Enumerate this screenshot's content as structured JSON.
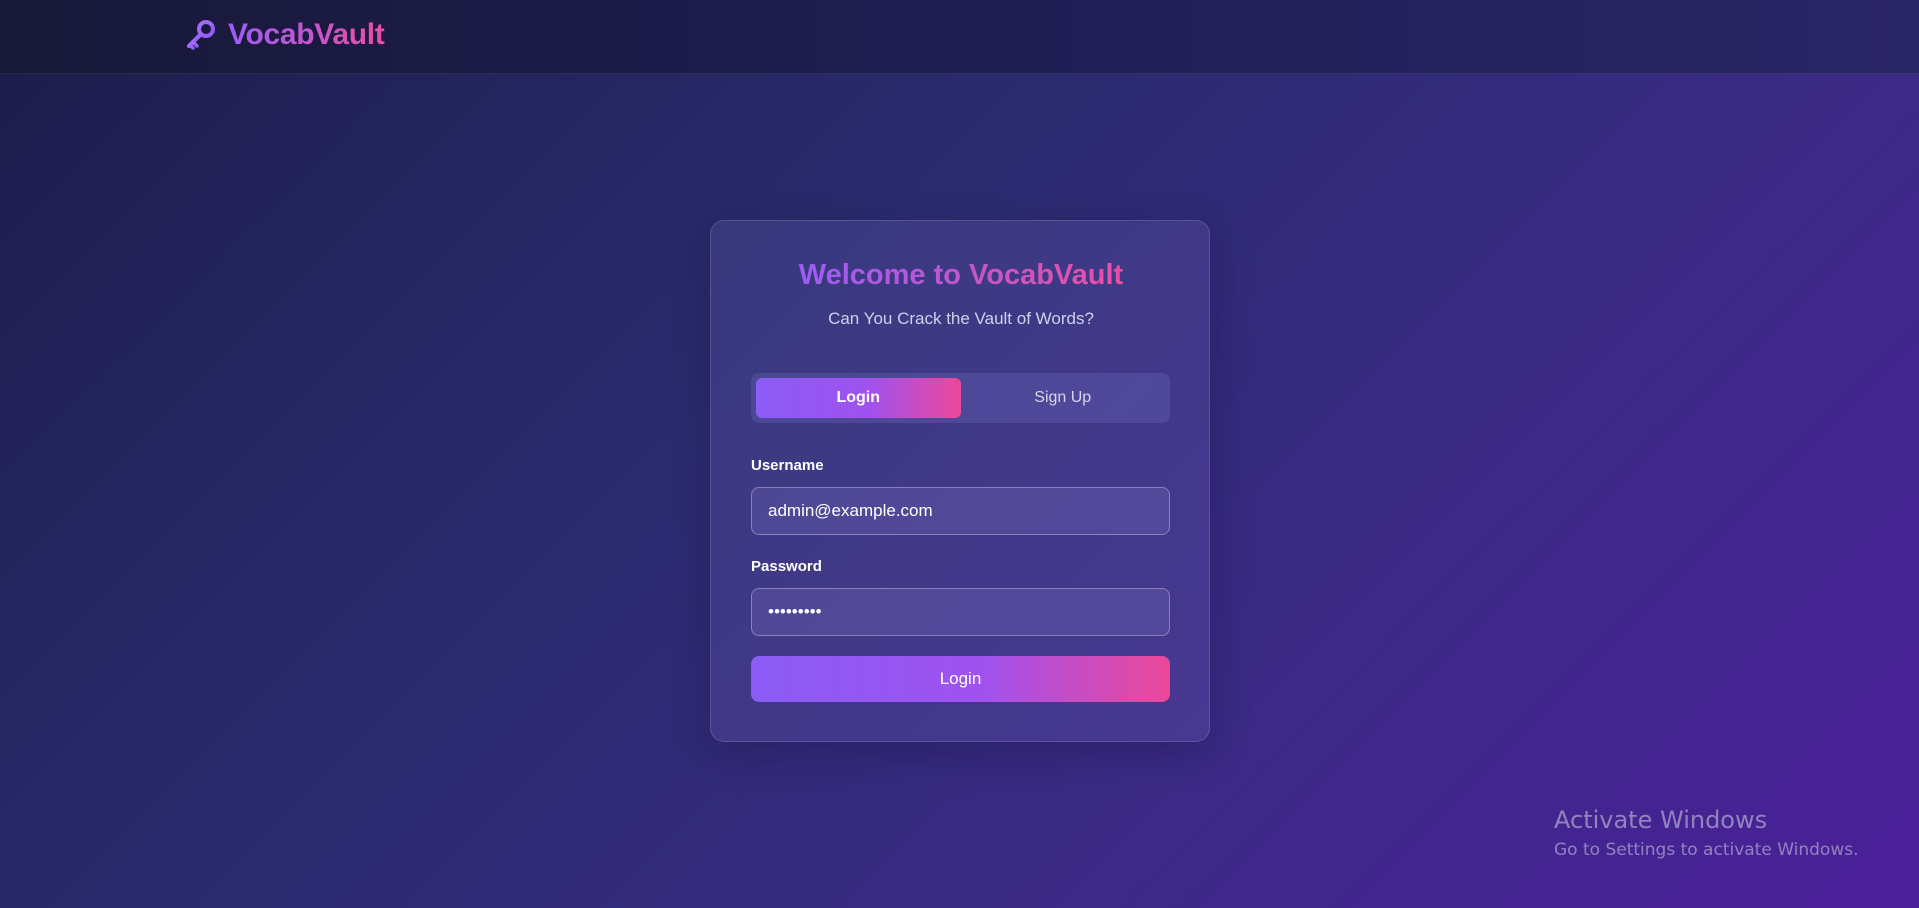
{
  "app": {
    "brand_name": "VocabVault",
    "brand_icon": "key-icon"
  },
  "colors": {
    "gradient_start": "#8b5cf6",
    "gradient_end": "#ec4899",
    "background_dark": "#1c1c4a",
    "background_purple": "#4b1f9a"
  },
  "login_card": {
    "title": "Welcome to VocabVault",
    "subtitle": "Can You Crack the Vault of Words?",
    "tabs": [
      {
        "label": "Login",
        "active": true
      },
      {
        "label": "Sign Up",
        "active": false
      }
    ],
    "username": {
      "label": "Username",
      "value": "admin@example.com"
    },
    "password": {
      "label": "Password",
      "value": "•••••••••"
    },
    "submit_label": "Login"
  },
  "watermark": {
    "title": "Activate Windows",
    "subtitle": "Go to Settings to activate Windows."
  }
}
